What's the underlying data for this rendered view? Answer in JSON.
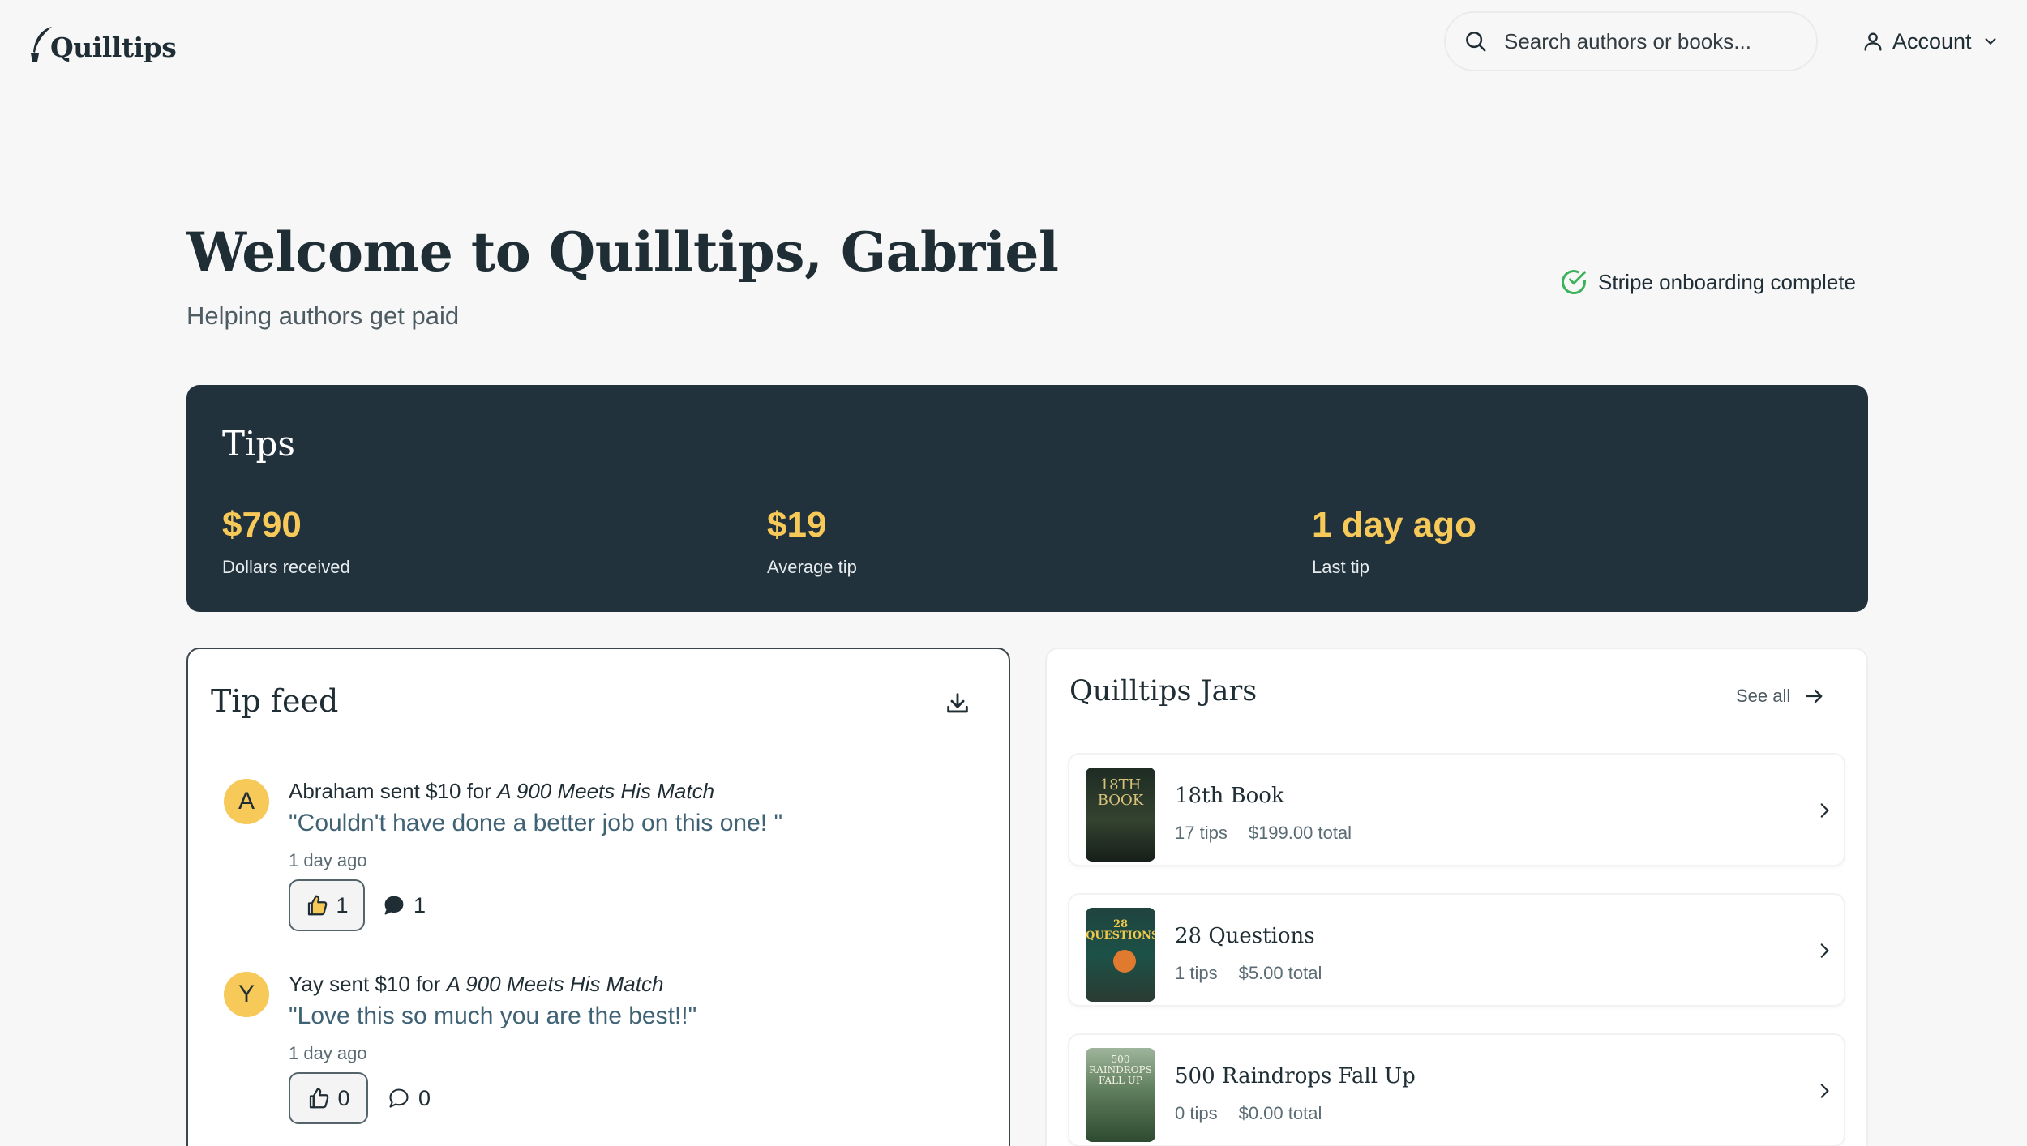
{
  "header": {
    "logo_text": "Quilltips",
    "search": {
      "placeholder": "Search authors or books..."
    },
    "account_label": "Account"
  },
  "welcome": {
    "title": "Welcome to Quilltips, Gabriel",
    "subtitle": "Helping authors get paid",
    "stripe_status": "Stripe onboarding complete"
  },
  "tips": {
    "title": "Tips",
    "stats": [
      {
        "value": "$790",
        "label": "Dollars received"
      },
      {
        "value": "$19",
        "label": "Average tip"
      },
      {
        "value": "1 day ago",
        "label": "Last tip"
      }
    ]
  },
  "feed": {
    "title": "Tip feed",
    "items": [
      {
        "initial": "A",
        "sender_text": "Abraham sent $10 for ",
        "book": "A 900 Meets His Match",
        "message": "\"Couldn't have done a better job on this one! \"",
        "time": "1 day ago",
        "likes": "1",
        "comments": "1"
      },
      {
        "initial": "Y",
        "sender_text": "Yay sent $10 for ",
        "book": "A 900 Meets His Match",
        "message": "\"Love this so much you are the best!!\"",
        "time": "1 day ago",
        "likes": "0",
        "comments": "0"
      }
    ]
  },
  "jars": {
    "title": "Quilltips Jars",
    "see_all": "See all",
    "items": [
      {
        "title": "18th Book",
        "tips": "17 tips",
        "total": "$199.00 total",
        "cover_text": "18TH BOOK"
      },
      {
        "title": "28 Questions",
        "tips": "1 tips",
        "total": "$5.00 total",
        "cover_text": "28 QUESTIONS"
      },
      {
        "title": "500 Raindrops Fall Up",
        "tips": "0 tips",
        "total": "$0.00 total",
        "cover_text": "500 RAINDROPS FALL UP"
      }
    ]
  },
  "colors": {
    "accent": "#f6c959",
    "banner": "#21323c",
    "success": "#3cb35a",
    "message": "#3f6275"
  }
}
